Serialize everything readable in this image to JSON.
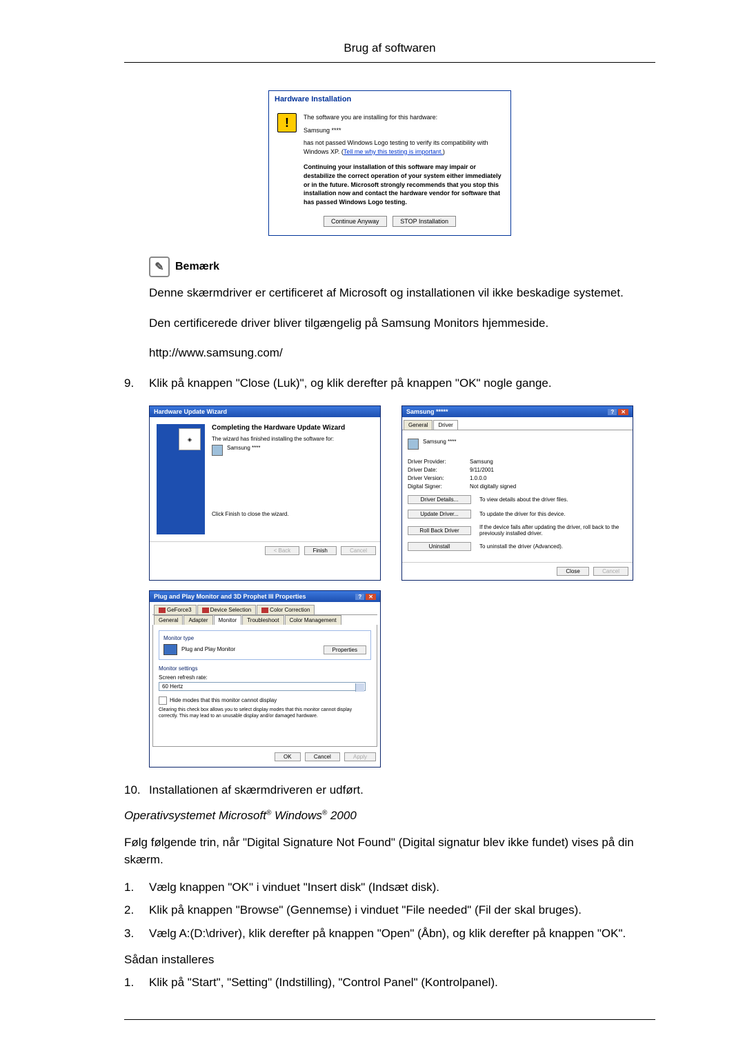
{
  "header": {
    "title": "Brug af softwaren"
  },
  "dialog_hw_install": {
    "title": "Hardware Installation",
    "line1": "The software you are installing for this hardware:",
    "device": "Samsung ****",
    "line2": "has not passed Windows Logo testing to verify its compatibility with Windows XP. (",
    "link": "Tell me why this testing is important.",
    "line2_end": ")",
    "bold": "Continuing your installation of this software may impair or destabilize the correct operation of your system either immediately or in the future. Microsoft strongly recommends that you stop this installation now and contact the hardware vendor for software that has passed Windows Logo testing.",
    "btn_continue": "Continue Anyway",
    "btn_stop": "STOP Installation"
  },
  "note": {
    "label": "Bemærk"
  },
  "p_cert": "Denne skærmdriver er certificeret af Microsoft og installationen vil ikke beskadige systemet.",
  "p_avail": "Den certificerede driver bliver tilgængelig på Samsung Monitors hjemmeside.",
  "p_url": "http://www.samsung.com/",
  "step9": {
    "num": "9.",
    "text": "Klik på knappen \"Close (Luk)\", og klik derefter på knappen \"OK\" nogle gange."
  },
  "wiz": {
    "title": "Hardware Update Wizard",
    "heading": "Completing the Hardware Update Wizard",
    "line1": "The wizard has finished installing the software for:",
    "device": "Samsung ****",
    "finish_text": "Click Finish to close the wizard.",
    "back": "< Back",
    "finish": "Finish",
    "cancel": "Cancel"
  },
  "drv": {
    "title": "Samsung *****",
    "tab_general": "General",
    "tab_driver": "Driver",
    "device": "Samsung ****",
    "lbl_provider": "Driver Provider:",
    "val_provider": "Samsung",
    "lbl_date": "Driver Date:",
    "val_date": "9/11/2001",
    "lbl_version": "Driver Version:",
    "val_version": "1.0.0.0",
    "lbl_signer": "Digital Signer:",
    "val_signer": "Not digitally signed",
    "btn_details": "Driver Details...",
    "desc_details": "To view details about the driver files.",
    "btn_update": "Update Driver...",
    "desc_update": "To update the driver for this device.",
    "btn_rollback": "Roll Back Driver",
    "desc_rollback": "If the device fails after updating the driver, roll back to the previously installed driver.",
    "btn_uninstall": "Uninstall",
    "desc_uninstall": "To uninstall the driver (Advanced).",
    "close": "Close",
    "cancel": "Cancel"
  },
  "prop": {
    "title": "Plug and Play Monitor and 3D Prophet III Properties",
    "tab_ge": "GeForce3",
    "tab_ds": "Device Selection",
    "tab_cc": "Color Correction",
    "tab_general": "General",
    "tab_adapter": "Adapter",
    "tab_monitor": "Monitor",
    "tab_trouble": "Troubleshoot",
    "tab_cm": "Color Management",
    "group_type": "Monitor type",
    "monitor_name": "Plug and Play Monitor",
    "btn_props": "Properties",
    "group_settings": "Monitor settings",
    "lbl_refresh": "Screen refresh rate:",
    "refresh_val": "60 Hertz",
    "chk_label": "Hide modes that this monitor cannot display",
    "chk_note": "Clearing this check box allows you to select display modes that this monitor cannot display correctly. This may lead to an unusable display and/or damaged hardware.",
    "ok": "OK",
    "cancel2": "Cancel",
    "apply": "Apply"
  },
  "step10": {
    "num": "10.",
    "text": "Installationen af skærmdriveren er udført."
  },
  "os_heading": {
    "pre": "Operativsystemet Microsoft",
    "mid": " Windows",
    "post": " 2000"
  },
  "p_follow": "Følg følgende trin, når \"Digital Signature Not Found\" (Digital signatur blev ikke fundet) vises på din skærm.",
  "s1": {
    "num": "1.",
    "text": "Vælg knappen \"OK\" i vinduet \"Insert disk\" (Indsæt disk)."
  },
  "s2": {
    "num": "2.",
    "text": "Klik på knappen \"Browse\" (Gennemse) i vinduet \"File needed\" (Fil der skal bruges)."
  },
  "s3": {
    "num": "3.",
    "text": "Vælg A:(D:\\driver), klik derefter på knappen \"Open\" (Åbn), og klik derefter på knappen \"OK\"."
  },
  "howto": "Sådan installeres",
  "h1": {
    "num": "1.",
    "text": "Klik på \"Start\", \"Setting\" (Indstilling), \"Control Panel\" (Kontrolpanel)."
  }
}
